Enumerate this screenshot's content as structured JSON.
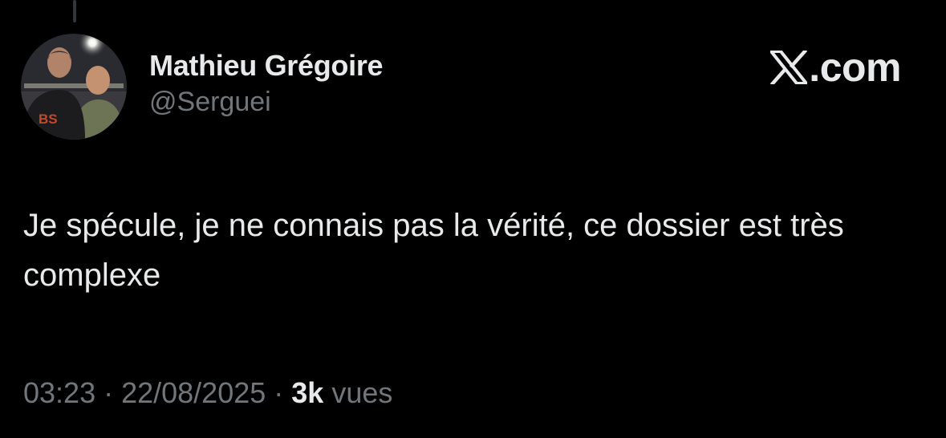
{
  "tweet": {
    "author": {
      "display_name": "Mathieu Grégoire",
      "handle": "@Serguei",
      "avatar": "profile-photo-two-men-night"
    },
    "brand": {
      "icon": "x-logo-icon",
      "domain": ".com"
    },
    "text": "Je spécule, je ne connais pas la vérité, ce dossier est très complexe",
    "meta": {
      "time": "03:23",
      "separator": "·",
      "date": "22/08/2025",
      "views_count": "3k",
      "views_label": "vues"
    }
  },
  "colors": {
    "background": "#000000",
    "primary_text": "#e7e9ea",
    "secondary_text": "#71767b",
    "thread_line": "#333639"
  }
}
